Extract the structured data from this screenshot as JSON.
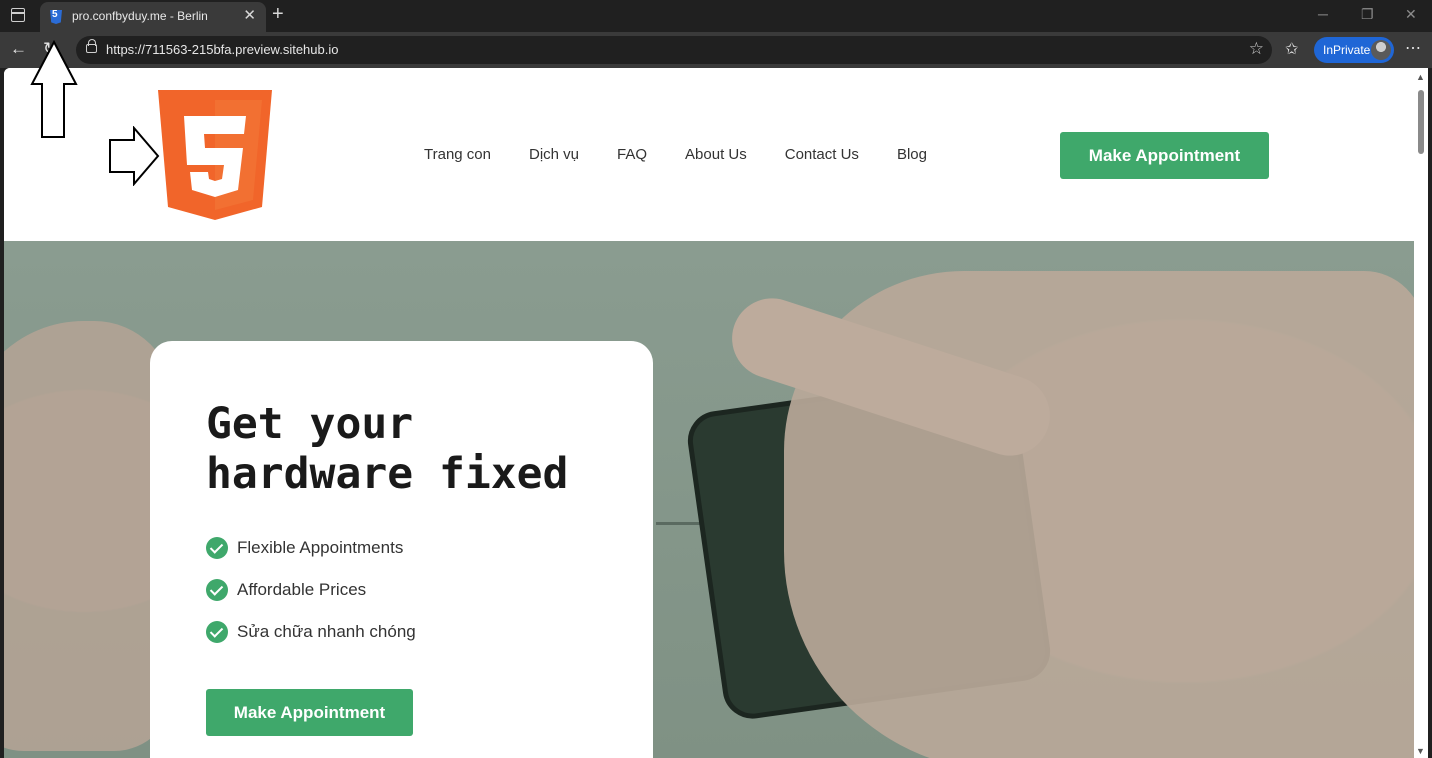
{
  "browser": {
    "tab_title": "pro.confbyduy.me - Berlin",
    "url": "https://711563-215bfa.preview.sitehub.io",
    "inprivate_label": "InPrivate",
    "new_tab_symbol": "+",
    "close_symbol": "✕"
  },
  "site": {
    "logo_alt": "html5-logo",
    "nav": [
      "Trang con",
      "Dịch vụ",
      "FAQ",
      "About Us",
      "Contact Us",
      "Blog"
    ],
    "header_cta": "Make Appointment"
  },
  "hero": {
    "headline": "Get your\nhardware fixed",
    "features": [
      "Flexible Appointments",
      "Affordable Prices",
      "Sửa chữa nhanh chóng"
    ],
    "cta": "Make Appointment"
  },
  "colors": {
    "accent_green": "#3fa86b",
    "html5_orange": "#f1652a",
    "browser_dark": "#202020",
    "inprivate_blue": "#1f66d6"
  }
}
